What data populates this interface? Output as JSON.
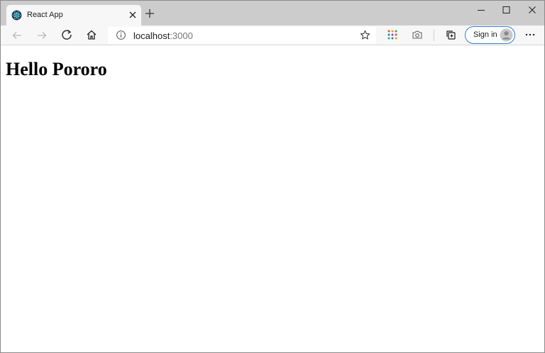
{
  "browser": {
    "tab": {
      "title": "React App",
      "favicon": "react-logo-icon"
    },
    "window_controls": [
      "minimize-icon",
      "maximize-icon",
      "close-icon"
    ],
    "toolbar": {
      "address_host": "localhost",
      "address_port": ":3000",
      "sign_in_label": "Sign in"
    },
    "colors": {
      "tab_strip": "#cccccc",
      "toolbar": "#f7f7f7",
      "sign_in_border": "#2f7fd6",
      "react_logo": "#61dafb"
    }
  },
  "page": {
    "heading": "Hello Pororo"
  }
}
